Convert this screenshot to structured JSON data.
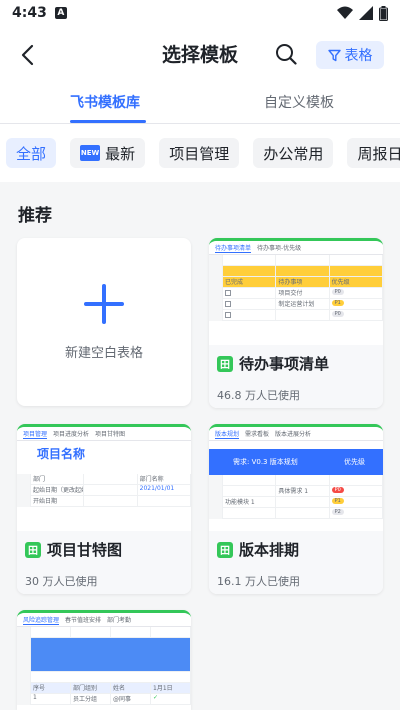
{
  "status": {
    "time": "4:43",
    "sim": "A"
  },
  "header": {
    "title": "选择模板",
    "filter_label": "表格"
  },
  "tabs": [
    {
      "label": "飞书模板库",
      "active": true
    },
    {
      "label": "自定义模板",
      "active": false
    }
  ],
  "chips": [
    {
      "label": "全部",
      "active": true,
      "badge": ""
    },
    {
      "label": "最新",
      "active": false,
      "badge": "NEW"
    },
    {
      "label": "项目管理",
      "active": false,
      "badge": ""
    },
    {
      "label": "办公常用",
      "active": false,
      "badge": ""
    },
    {
      "label": "周报日志",
      "active": false,
      "badge": ""
    }
  ],
  "section_title": "推荐",
  "blank_card": {
    "label": "新建空白表格"
  },
  "templates": [
    {
      "name": "待办事项清单",
      "usage": "46.8 万人已使用",
      "preview_tabs": [
        "待办事项清单",
        "待办事项-优先级"
      ],
      "rows": [
        [
          "已完成",
          "待办事项",
          "优先级"
        ],
        [
          "",
          "项目交付",
          "P0"
        ],
        [
          "",
          "制定运营计划",
          "P1"
        ],
        [
          "",
          "",
          "P0"
        ]
      ]
    },
    {
      "name": "项目甘特图",
      "usage": "30 万人已使用",
      "preview_tabs": [
        "项目管理",
        "项目进度分析",
        "项目甘特图"
      ],
      "heading": "项目名称",
      "rows": [
        [
          "部门",
          "",
          "部门名称"
        ],
        [
          "起始日期（更改起始更新）",
          "",
          "2021/01/01"
        ],
        [
          "开始日期",
          "",
          ""
        ]
      ]
    },
    {
      "name": "版本排期",
      "usage": "16.1 万人已使用",
      "preview_tabs": [
        "版本规划",
        "需求看板",
        "版本进展分析"
      ],
      "banner": "需求: V0.3 版本规划",
      "banner_right": "优先级",
      "rows": [
        [
          "",
          "",
          ""
        ],
        [
          "",
          "具体需求 1",
          "P0"
        ],
        [
          "功能模块 1",
          "",
          "P1"
        ],
        [
          "",
          "",
          "P2"
        ]
      ]
    },
    {
      "name": "",
      "usage": "",
      "preview_tabs": [
        "风险追踪管理",
        "春节值班安排",
        "部门考勤"
      ],
      "rows": [
        [
          "序号",
          "部门组别",
          "姓名",
          "1月1日"
        ],
        [
          "1",
          "员工分组",
          "@同事",
          "✓"
        ]
      ]
    }
  ]
}
